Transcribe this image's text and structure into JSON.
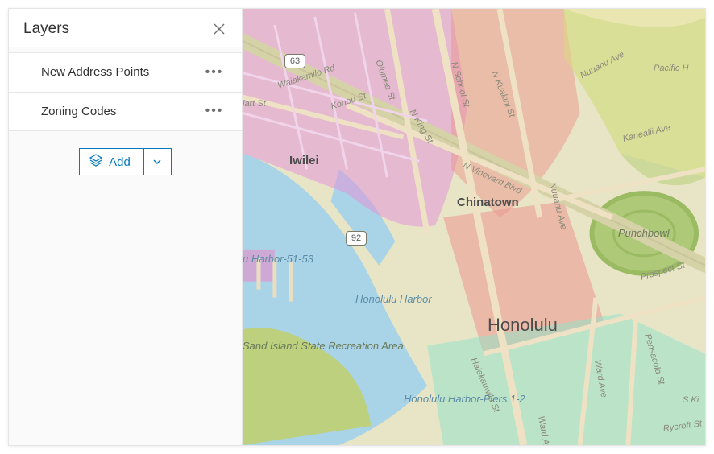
{
  "panel": {
    "title": "Layers",
    "layers": [
      {
        "label": "New Address Points"
      },
      {
        "label": "Zoning Codes"
      }
    ],
    "add_label": "Add"
  },
  "map": {
    "city": "Honolulu",
    "towns": [
      "Iwilei",
      "Chinatown"
    ],
    "poi": [
      "Punchbowl",
      "Sand Island State Recreation Area"
    ],
    "water": [
      "Honolulu Harbor",
      "u Harbor-51-53",
      "Honolulu Harbor-Piers 1-2"
    ],
    "shields": [
      "63",
      "92"
    ],
    "streets": [
      "Waiakamilo Rd",
      "iart St",
      "Kohou St",
      "Olomea St",
      "N King St",
      "N School St",
      "N Kuakini St",
      "N Vineyard Blvd",
      "Nuuanu Ave",
      "Nuuanu Ave",
      "Pacific H",
      "Kanealii Ave",
      "Prospect St",
      "Pensacola St",
      "S Ki",
      "Rycroft St",
      "Ward Ave",
      "Ward Ave",
      "Halekauwila St"
    ]
  },
  "colors": {
    "panel_border": "#e6e6e6",
    "accent": "#0079c1",
    "zone_pink": "rgba(230,140,210,0.55)",
    "zone_red": "rgba(235,140,130,0.55)",
    "zone_mint": "rgba(160,220,200,0.55)",
    "zone_yellow": "rgba(235,230,150,0.55)",
    "water_c": "#a9d3e6",
    "land_c": "#e8e5c7",
    "green_c": "#b8cf7a"
  }
}
